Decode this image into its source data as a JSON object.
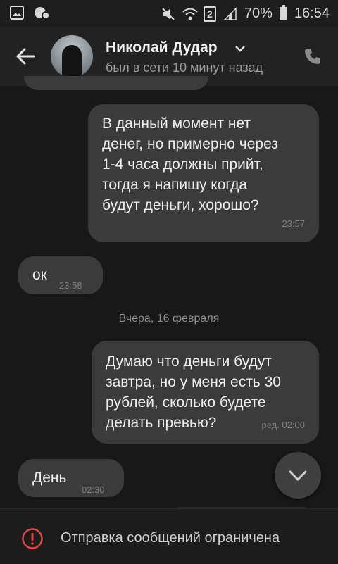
{
  "status_bar": {
    "battery": "70%",
    "time": "16:54",
    "sim_slot": "2",
    "icons": [
      "gallery-icon",
      "notification-icon",
      "mute-icon",
      "wifi-icon",
      "sim-icon",
      "signal-icon",
      "battery-icon"
    ]
  },
  "header": {
    "name": "Николай Дудар",
    "last_seen": "был в сети 10 минут назад"
  },
  "messages": [
    {
      "side": "out",
      "text": "В данный момент нет\nденег, но примерно через\n1-4 часа должны прийт,\nтогда я напишу когда\nбудут деньги, хорошо?",
      "time": "23:57"
    },
    {
      "side": "in",
      "text": "ок",
      "time": "23:58"
    },
    {
      "side": "out",
      "text": "Думаю что деньги будут\nзавтра, но у меня есть 30\nрублей, сколько будете\nделать превью?",
      "time": "ред. 02:00"
    },
    {
      "side": "in",
      "text": "День",
      "time": "02:30"
    }
  ],
  "date_separator": "Вчера, 16 февраля",
  "footer": {
    "text": "Отправка сообщений ограничена"
  },
  "colors": {
    "background": "#181818",
    "bubble": "#3b3b3b",
    "warning": "#e0454a"
  }
}
